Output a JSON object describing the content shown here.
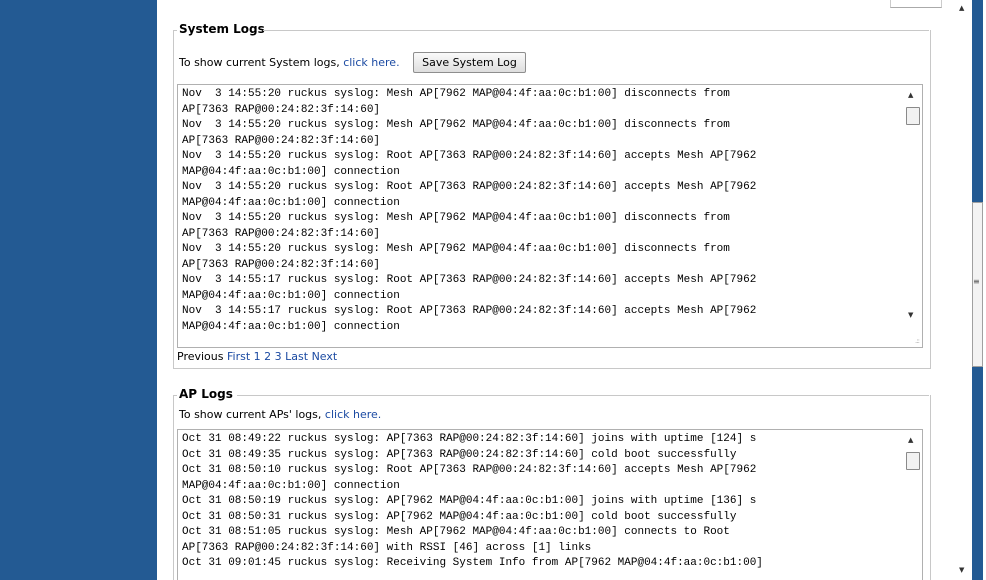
{
  "system_logs": {
    "title": "System Logs",
    "intro_text": "To show current System logs,",
    "intro_link": "click here.",
    "save_button": "Save System Log",
    "lines": [
      "Nov  3 14:55:20 ruckus syslog: Mesh AP[7962 MAP@04:4f:aa:0c:b1:00] disconnects from",
      "AP[7363 RAP@00:24:82:3f:14:60]",
      "Nov  3 14:55:20 ruckus syslog: Mesh AP[7962 MAP@04:4f:aa:0c:b1:00] disconnects from",
      "AP[7363 RAP@00:24:82:3f:14:60]",
      "Nov  3 14:55:20 ruckus syslog: Root AP[7363 RAP@00:24:82:3f:14:60] accepts Mesh AP[7962",
      "MAP@04:4f:aa:0c:b1:00] connection",
      "Nov  3 14:55:20 ruckus syslog: Root AP[7363 RAP@00:24:82:3f:14:60] accepts Mesh AP[7962",
      "MAP@04:4f:aa:0c:b1:00] connection",
      "Nov  3 14:55:20 ruckus syslog: Mesh AP[7962 MAP@04:4f:aa:0c:b1:00] disconnects from",
      "AP[7363 RAP@00:24:82:3f:14:60]",
      "Nov  3 14:55:20 ruckus syslog: Mesh AP[7962 MAP@04:4f:aa:0c:b1:00] disconnects from",
      "AP[7363 RAP@00:24:82:3f:14:60]",
      "Nov  3 14:55:17 ruckus syslog: Root AP[7363 RAP@00:24:82:3f:14:60] accepts Mesh AP[7962",
      "MAP@04:4f:aa:0c:b1:00] connection",
      "Nov  3 14:55:17 ruckus syslog: Root AP[7363 RAP@00:24:82:3f:14:60] accepts Mesh AP[7962",
      "MAP@04:4f:aa:0c:b1:00] connection"
    ],
    "pager": {
      "previous": "Previous",
      "first": "First",
      "pages": [
        "1",
        "2",
        "3"
      ],
      "last": "Last",
      "next": "Next"
    }
  },
  "ap_logs": {
    "title": "AP Logs",
    "intro_text": "To show current APs' logs,",
    "intro_link": "click here.",
    "lines": [
      "Oct 31 08:49:22 ruckus syslog: AP[7363 RAP@00:24:82:3f:14:60] joins with uptime [124] s",
      "Oct 31 08:49:35 ruckus syslog: AP[7363 RAP@00:24:82:3f:14:60] cold boot successfully",
      "Oct 31 08:50:10 ruckus syslog: Root AP[7363 RAP@00:24:82:3f:14:60] accepts Mesh AP[7962",
      "MAP@04:4f:aa:0c:b1:00] connection",
      "Oct 31 08:50:19 ruckus syslog: AP[7962 MAP@04:4f:aa:0c:b1:00] joins with uptime [136] s",
      "Oct 31 08:50:31 ruckus syslog: AP[7962 MAP@04:4f:aa:0c:b1:00] cold boot successfully",
      "Oct 31 08:51:05 ruckus syslog: Mesh AP[7962 MAP@04:4f:aa:0c:b1:00] connects to Root",
      "AP[7363 RAP@00:24:82:3f:14:60] with RSSI [46] across [1] links",
      "Oct 31 09:01:45 ruckus syslog: Receiving System Info from AP[7962 MAP@04:4f:aa:0c:b1:00]"
    ]
  },
  "colors": {
    "nav_bg": "#235a93",
    "link": "#1b4aa2",
    "border": "#c8c8c8"
  },
  "icons": [
    "scroll-up-arrow-icon",
    "scroll-down-arrow-icon",
    "resize-grip-icon",
    "scrollbar-grip-icon"
  ]
}
